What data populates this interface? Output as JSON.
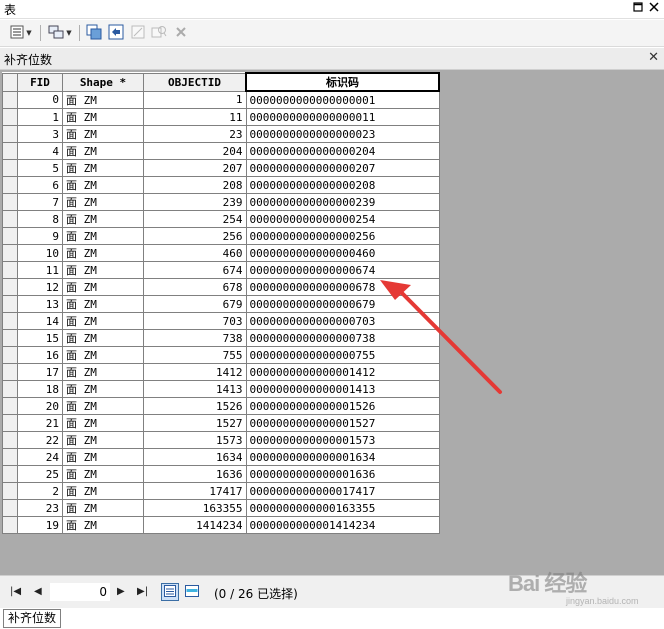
{
  "window": {
    "title": "表"
  },
  "tab": {
    "title": "补齐位数"
  },
  "table": {
    "columns": [
      "FID",
      "Shape *",
      "OBJECTID",
      "标识码"
    ],
    "rows": [
      [
        "0",
        "面 ZM",
        "1",
        "0000000000000000001"
      ],
      [
        "1",
        "面 ZM",
        "11",
        "0000000000000000011"
      ],
      [
        "3",
        "面 ZM",
        "23",
        "0000000000000000023"
      ],
      [
        "4",
        "面 ZM",
        "204",
        "0000000000000000204"
      ],
      [
        "5",
        "面 ZM",
        "207",
        "0000000000000000207"
      ],
      [
        "6",
        "面 ZM",
        "208",
        "0000000000000000208"
      ],
      [
        "7",
        "面 ZM",
        "239",
        "0000000000000000239"
      ],
      [
        "8",
        "面 ZM",
        "254",
        "0000000000000000254"
      ],
      [
        "9",
        "面 ZM",
        "256",
        "0000000000000000256"
      ],
      [
        "10",
        "面 ZM",
        "460",
        "0000000000000000460"
      ],
      [
        "11",
        "面 ZM",
        "674",
        "0000000000000000674"
      ],
      [
        "12",
        "面 ZM",
        "678",
        "0000000000000000678"
      ],
      [
        "13",
        "面 ZM",
        "679",
        "0000000000000000679"
      ],
      [
        "14",
        "面 ZM",
        "703",
        "0000000000000000703"
      ],
      [
        "15",
        "面 ZM",
        "738",
        "0000000000000000738"
      ],
      [
        "16",
        "面 ZM",
        "755",
        "0000000000000000755"
      ],
      [
        "17",
        "面 ZM",
        "1412",
        "0000000000000001412"
      ],
      [
        "18",
        "面 ZM",
        "1413",
        "0000000000000001413"
      ],
      [
        "20",
        "面 ZM",
        "1526",
        "0000000000000001526"
      ],
      [
        "21",
        "面 ZM",
        "1527",
        "0000000000000001527"
      ],
      [
        "22",
        "面 ZM",
        "1573",
        "0000000000000001573"
      ],
      [
        "24",
        "面 ZM",
        "1634",
        "0000000000000001634"
      ],
      [
        "25",
        "面 ZM",
        "1636",
        "0000000000000001636"
      ],
      [
        "2",
        "面 ZM",
        "17417",
        "0000000000000017417"
      ],
      [
        "23",
        "面 ZM",
        "163355",
        "0000000000000163355"
      ],
      [
        "19",
        "面 ZM",
        "1414234",
        "0000000000001414234"
      ]
    ]
  },
  "status": {
    "record_index": "0",
    "selection_text": "(0 / 26 已选择)"
  },
  "bottom_tab": {
    "label": "补齐位数"
  },
  "watermark": {
    "text": "Bai 经验",
    "sub": "jingyan.baidu.com"
  },
  "icons": {
    "table_options": "table-options-icon",
    "related_tables": "related-tables-icon",
    "select_by_attributes": "select-by-attributes-icon",
    "switch_selection": "switch-selection-icon",
    "clear_selection": "clear-selection-icon",
    "zoom_to_selected": "zoom-to-selected-icon",
    "delete_selected": "delete-selected-icon"
  },
  "colors": {
    "arrow": "#e53935",
    "grid_background": "#ababab",
    "header_background": "#f0f0f0",
    "active_view": "#cde0f7"
  }
}
